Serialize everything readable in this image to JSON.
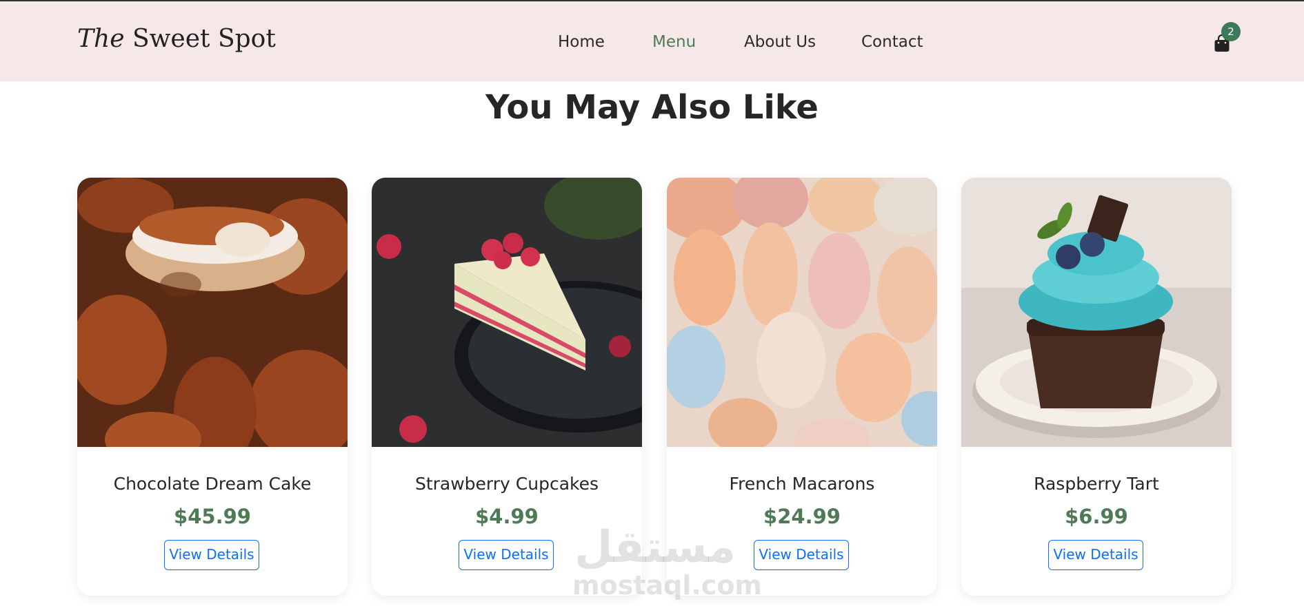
{
  "brand": {
    "part1": "The",
    "part2": " Sweet Spot"
  },
  "nav": {
    "items": [
      "Home",
      "Menu",
      "About Us",
      "Contact"
    ],
    "active": "Menu"
  },
  "cart": {
    "count": "2",
    "icon": "shopping-bag-icon"
  },
  "section": {
    "title": "You May Also Like"
  },
  "products": [
    {
      "name": "Chocolate Dream Cake",
      "price": "$45.99",
      "button": "View Details",
      "image": "tiramisu-photo"
    },
    {
      "name": "Strawberry Cupcakes",
      "price": "$4.99",
      "button": "View Details",
      "image": "raspberry-layer-cake-photo"
    },
    {
      "name": "French Macarons",
      "price": "$24.99",
      "button": "View Details",
      "image": "macarons-photo"
    },
    {
      "name": "Raspberry Tart",
      "price": "$6.99",
      "button": "View Details",
      "image": "teal-frosted-cupcake-photo"
    }
  ],
  "watermark": {
    "arabic": "مستقل",
    "latin": "mostaql.com"
  },
  "colors": {
    "navbar": "#f6e8e8",
    "accent": "#4e7a56",
    "button": "#0d6efd",
    "badge": "#3b7a57"
  }
}
